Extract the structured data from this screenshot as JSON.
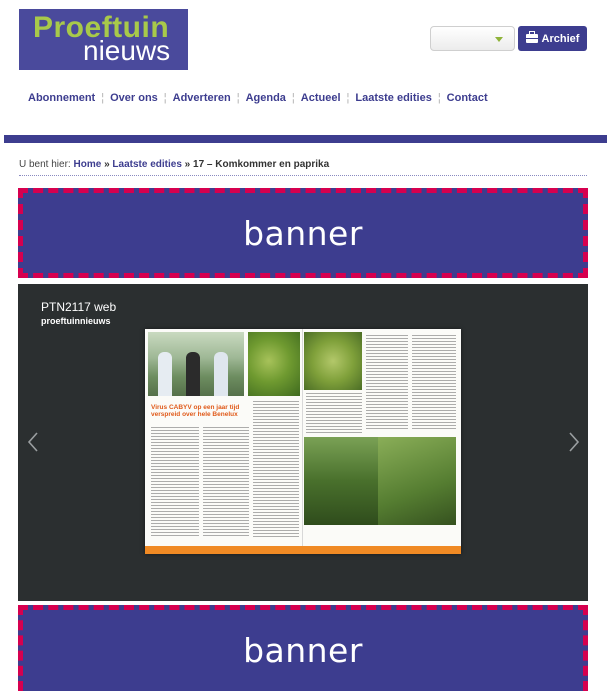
{
  "logo": {
    "line1": "Proeftuin",
    "line2": "nieuws"
  },
  "header": {
    "dropdown_value": "",
    "archief_label": "Archief"
  },
  "nav": {
    "items": [
      "Abonnement",
      "Over ons",
      "Adverteren",
      "Agenda",
      "Actueel",
      "Laatste edities",
      "Contact"
    ]
  },
  "breadcrumb": {
    "prefix": "U bent hier:",
    "home": "Home",
    "sep1": "»",
    "section": "Laatste edities",
    "sep2": "»",
    "current": "17 – Komkommer en paprika"
  },
  "banners": {
    "top": "banner",
    "bottom": "banner"
  },
  "viewer": {
    "title": "PTN2117 web",
    "subtitle": "proeftuinnieuws",
    "article_headline": "Virus CABYV op een jaar tijd verspreid over hele Benelux"
  },
  "colors": {
    "brand": "#3d3d8f",
    "accent": "#a8c94a",
    "banner_border": "#d6004f",
    "viewer_bg": "#2b2f30",
    "article_orange": "#f08a24"
  }
}
